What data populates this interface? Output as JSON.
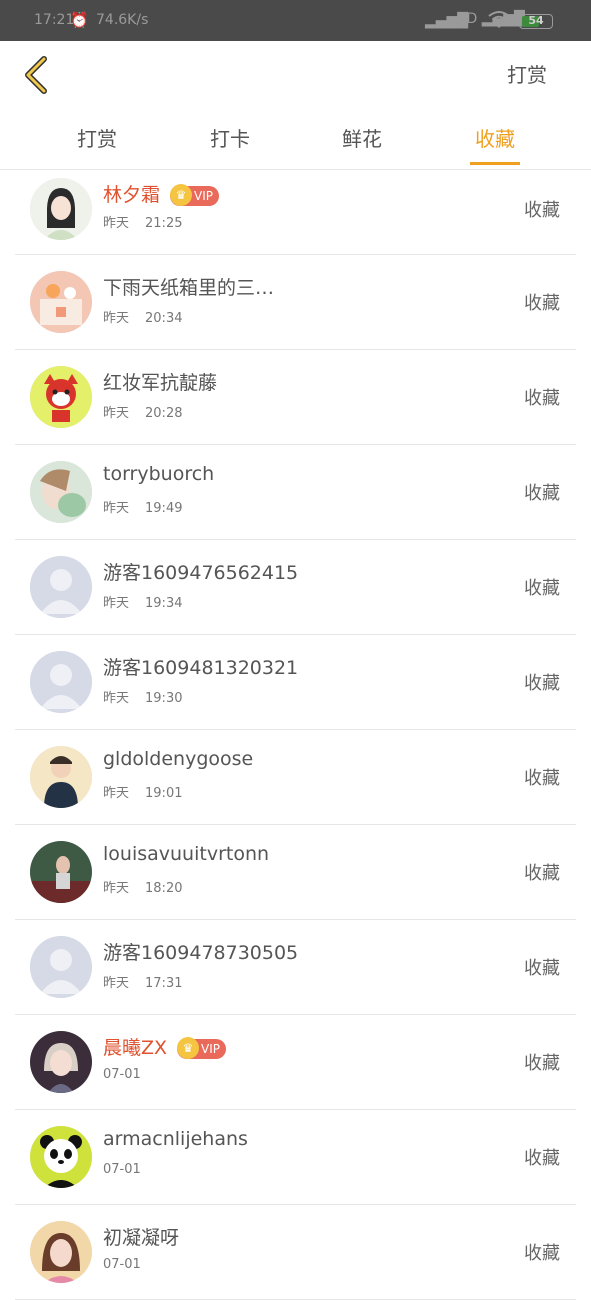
{
  "status_bar": {
    "time": "17:21",
    "speed": "74.6K/s",
    "signal1": "▂▄▆█",
    "signal2": "HD ▂▄▆█",
    "battery": "54",
    "icons": [
      "alarm-icon",
      "signal-icon",
      "wifi-icon",
      "battery-icon"
    ]
  },
  "header": {
    "back_icon": "chevron-left-icon",
    "action_label": "打赏"
  },
  "tabs": [
    {
      "label": "打赏",
      "active": false
    },
    {
      "label": "打卡",
      "active": false
    },
    {
      "label": "鲜花",
      "active": false
    },
    {
      "label": "收藏",
      "active": true
    }
  ],
  "colors": {
    "accent": "#f0a020",
    "vip_name": "#e0522f",
    "vip_badge": "#e9695a"
  },
  "rows": [
    {
      "name": "林夕霜",
      "vip": true,
      "vip_label": "VIP",
      "date": "昨天",
      "time": "21:25",
      "action": "收藏",
      "avatar": "girl-illustration"
    },
    {
      "name": "下雨天纸箱里的三…",
      "vip": false,
      "date": "昨天",
      "time": "20:34",
      "action": "收藏",
      "avatar": "cartoon-peach"
    },
    {
      "name": "红妆军抗靛藤",
      "vip": false,
      "date": "昨天",
      "time": "20:28",
      "action": "收藏",
      "avatar": "red-fox-cartoon"
    },
    {
      "name": "torrybuorch",
      "vip": false,
      "date": "昨天",
      "time": "19:49",
      "action": "收藏",
      "avatar": "photo-girl"
    },
    {
      "name": "游客1609476562415",
      "vip": false,
      "date": "昨天",
      "time": "19:34",
      "action": "收藏",
      "avatar": "default-user"
    },
    {
      "name": "游客1609481320321",
      "vip": false,
      "date": "昨天",
      "time": "19:30",
      "action": "收藏",
      "avatar": "default-user"
    },
    {
      "name": "gldoldenygoose",
      "vip": false,
      "date": "昨天",
      "time": "19:01",
      "action": "收藏",
      "avatar": "photo-boy"
    },
    {
      "name": "louisavuuitvrtonn",
      "vip": false,
      "date": "昨天",
      "time": "18:20",
      "action": "收藏",
      "avatar": "photo-dark"
    },
    {
      "name": "游客1609478730505",
      "vip": false,
      "date": "昨天",
      "time": "17:31",
      "action": "收藏",
      "avatar": "default-user"
    },
    {
      "name": "晨曦ZX",
      "vip": true,
      "vip_label": "VIP",
      "date": "07-01",
      "time": "",
      "action": "收藏",
      "avatar": "illustration-girl-dark"
    },
    {
      "name": "armacnlijehans",
      "vip": false,
      "date": "07-01",
      "time": "",
      "action": "收藏",
      "avatar": "panda-cartoon"
    },
    {
      "name": "初凝凝呀",
      "vip": false,
      "date": "07-01",
      "time": "",
      "action": "收藏",
      "avatar": "photo-girl-pink"
    }
  ]
}
